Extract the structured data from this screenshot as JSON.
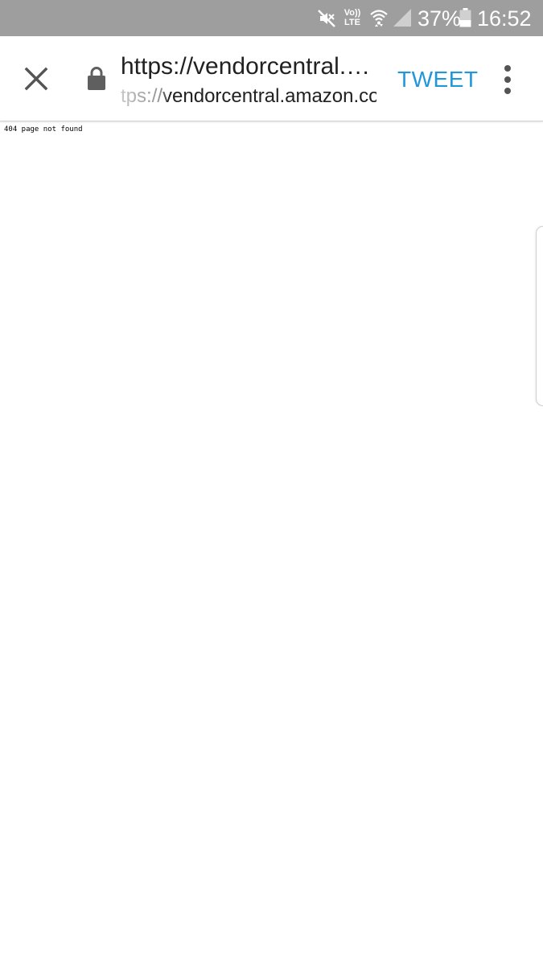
{
  "status_bar": {
    "volte_top": "Vo))",
    "volte_bottom": "LTE",
    "battery_percent": "37%",
    "time": "16:52",
    "icons": [
      "mute-icon",
      "wifi-icon",
      "signal-icon",
      "battery-icon"
    ],
    "background_color": "#9e9e9e"
  },
  "toolbar": {
    "url_title": "https://vendorcentral.…",
    "url_full": "https://vendorcentral.amazon.com",
    "action_label": "TWEET",
    "action_color": "#2196d9",
    "icons": [
      "close-icon",
      "lock-icon",
      "more-vert-icon"
    ]
  },
  "page": {
    "message": "404 page not found"
  }
}
